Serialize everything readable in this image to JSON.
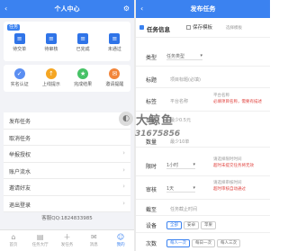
{
  "left": {
    "header": {
      "title": "个人中心",
      "back": "‹",
      "settings": "⚙"
    },
    "tasks_label": "任务",
    "task_items": [
      {
        "label": "待交单",
        "icon": "≡"
      },
      {
        "label": "待审核",
        "icon": "≡"
      },
      {
        "label": "已完成",
        "icon": "≡"
      },
      {
        "label": "未通过",
        "icon": "≡"
      }
    ],
    "task_items2": [
      {
        "label": "实名认证",
        "icon": "✓",
        "color": "#5a8ef2"
      },
      {
        "label": "上线提示",
        "icon": "↑",
        "color": "#f5a623"
      },
      {
        "label": "完成结果",
        "icon": "★",
        "color": "#46c266"
      },
      {
        "label": "邀请提醒",
        "icon": "✉",
        "color": "#f2853a"
      }
    ],
    "menu": [
      {
        "label": "发布任务"
      },
      {
        "label": "取消任务"
      },
      {
        "label": "举报授权"
      },
      {
        "label": "账户流水"
      },
      {
        "label": "邀请好友"
      },
      {
        "label": "退出登录"
      }
    ],
    "service_qq": "客服QQ:1824833985",
    "tabs": [
      {
        "label": "首页",
        "icon": "⌂"
      },
      {
        "label": "任务大厅",
        "icon": "▤"
      },
      {
        "label": "发任务",
        "icon": "＋"
      },
      {
        "label": "消息",
        "icon": "✉"
      },
      {
        "label": "我的",
        "icon": "☺",
        "active": true
      }
    ]
  },
  "right": {
    "header": {
      "title": "发布任务",
      "back": "‹"
    },
    "task_info": "任务信息",
    "save_template": "保存模板",
    "select_template": "选择模板",
    "rows": {
      "type": {
        "key": "类型",
        "value": "任务类型"
      },
      "title": {
        "key": "标题",
        "value": "项目标题(必填)"
      },
      "platform": {
        "key": "标签",
        "value": "平台名称",
        "hint1": "平台名称",
        "hint2": "必填项目名称，需要有描述"
      },
      "price": {
        "key": "单价",
        "value": "最少0.5元"
      },
      "quantity": {
        "key": "数量",
        "value": "最少10单"
      },
      "limit": {
        "key": "限时",
        "value": "1小时",
        "hint1": "请选择限时时间",
        "hint2": "超时未提交任务将无效"
      },
      "review": {
        "key": "审核",
        "value": "1天",
        "hint1": "请选择审核时间",
        "hint2": "超时审核自动通过"
      },
      "deadline": {
        "key": "截至",
        "value": "任务截止时间"
      },
      "device": {
        "key": "设备",
        "opts": [
          "全部",
          "安卓",
          "苹果"
        ]
      },
      "times": {
        "key": "次数",
        "opts": [
          "每人一次",
          "每日一次",
          "每人三次"
        ]
      }
    }
  },
  "watermark": {
    "name": "大鲸鱼",
    "number": "31675856"
  }
}
